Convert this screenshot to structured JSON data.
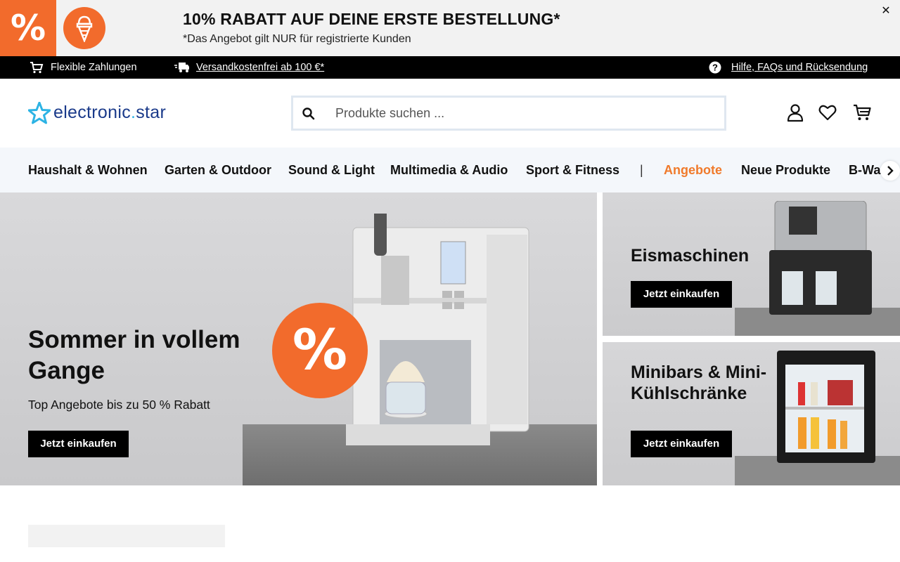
{
  "promo": {
    "badge": "%",
    "title": "10% RABATT AUF DEINE ERSTE BESTELLUNG*",
    "subtitle": "*Das Angebot gilt NUR für registrierte Kunden",
    "close": "✕"
  },
  "infobar": {
    "payments": "Flexible Zahlungen",
    "shipping": "Versandkostenfrei ab 100 €*",
    "help": "Hilfe, FAQs und Rücksendung"
  },
  "header": {
    "logo_main": "electronic",
    "logo_dot": ".",
    "logo_end": "star",
    "search_placeholder": "Produkte suchen ..."
  },
  "nav": {
    "items": [
      "Haushalt & Wohnen",
      "Garten & Outdoor",
      "Sound & Light",
      "Multimedia & Audio",
      "Sport & Fitness"
    ],
    "separator": "|",
    "sale": "Angebote",
    "new": "Neue Produkte",
    "bware": "B-Ware"
  },
  "hero": {
    "badge": "%",
    "title": "Sommer in vollem Gange",
    "subtitle": "Top Angebote bis zu 50 % Rabatt",
    "cta": "Jetzt einkaufen"
  },
  "tiles": [
    {
      "title": "Eismaschinen",
      "cta": "Jetzt einkaufen"
    },
    {
      "title": "Minibars & Mini-Kühlschränke",
      "cta": "Jetzt einkaufen"
    }
  ],
  "colors": {
    "accent_orange": "#f26b2c",
    "brand_blue": "#1a3a8a",
    "brand_cyan": "#2cb3e4"
  }
}
